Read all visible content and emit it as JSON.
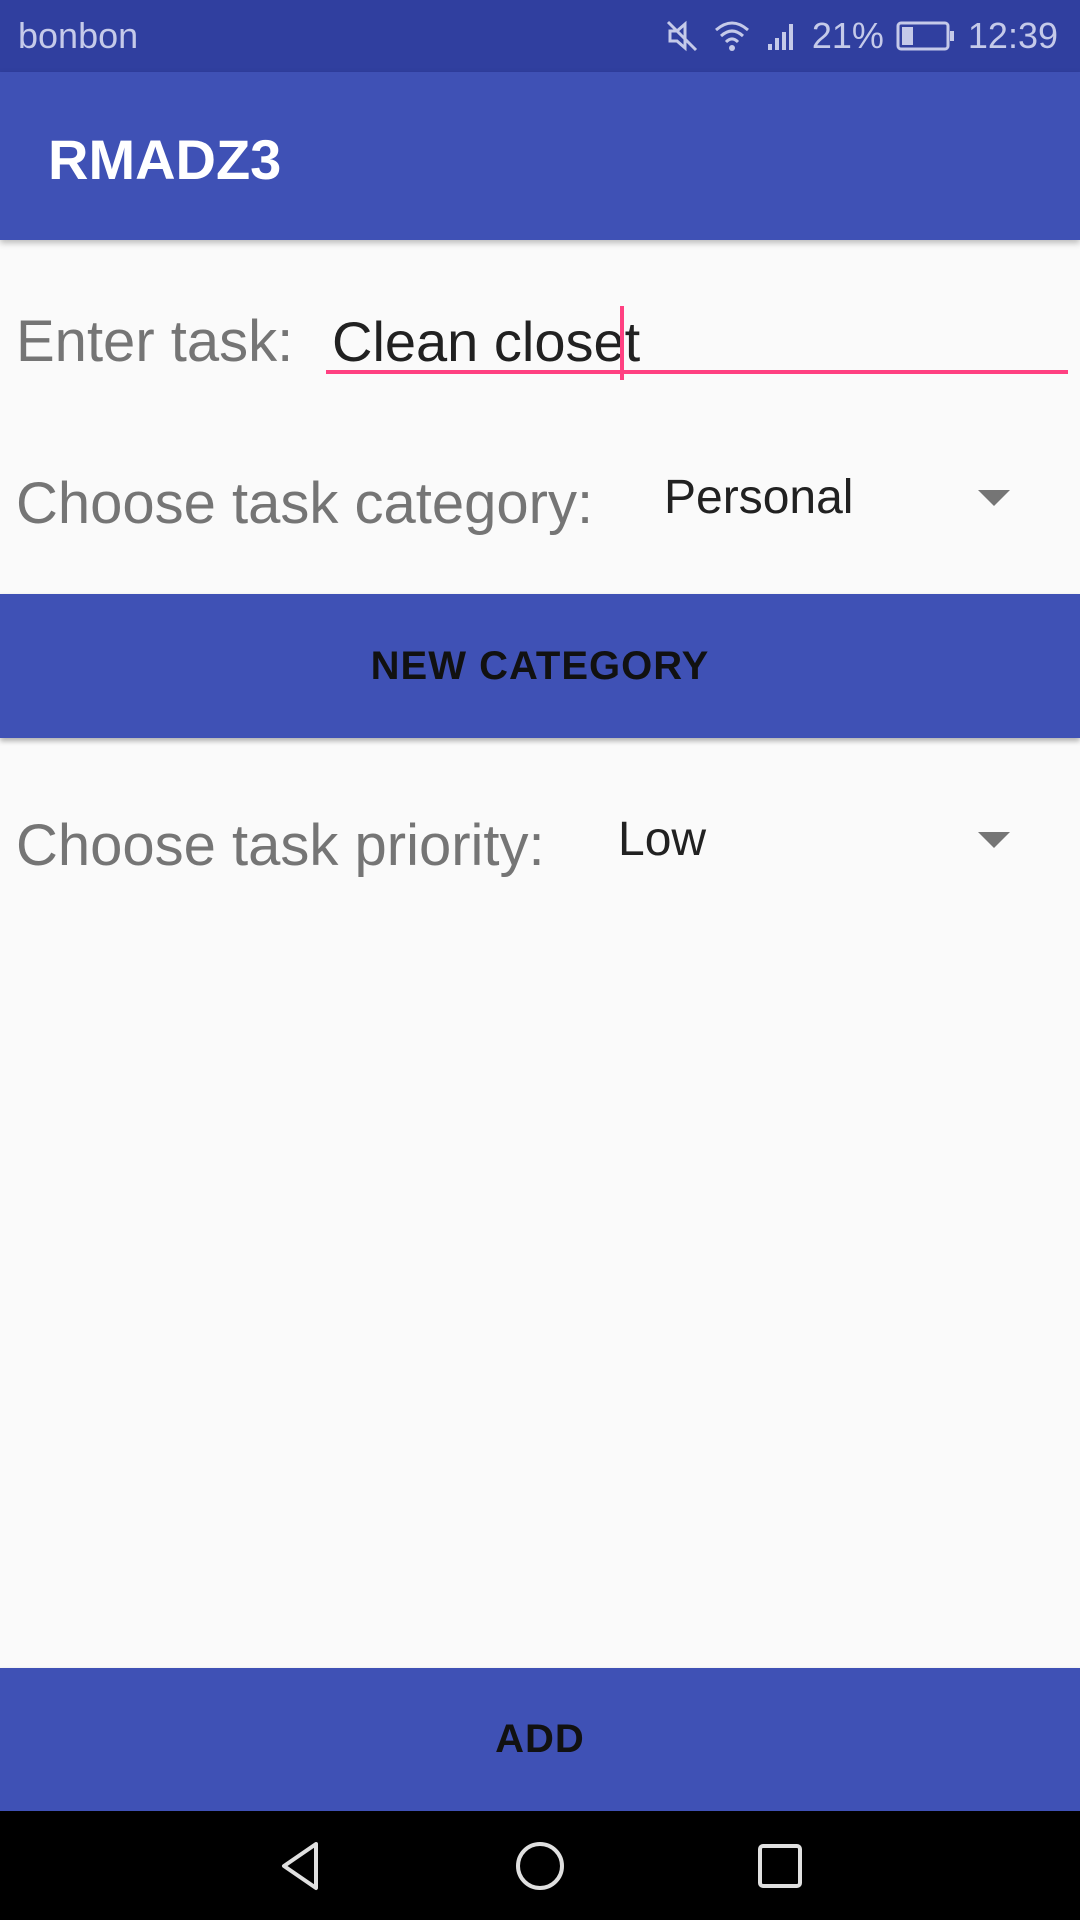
{
  "status_bar": {
    "carrier": "bonbon",
    "battery_percent": "21%",
    "time": "12:39",
    "icons": [
      "mute-icon",
      "wifi-icon",
      "signal-icon",
      "battery-icon"
    ]
  },
  "app_bar": {
    "title": "RMADZ3"
  },
  "form": {
    "task_label": "Enter task:",
    "task_value": "Clean closet",
    "category_label": "Choose task category:",
    "category_value": "Personal",
    "new_category_button": "NEW CATEGORY",
    "priority_label": "Choose task priority:",
    "priority_value": "Low",
    "add_button": "ADD"
  },
  "nav_bar": {
    "icons": [
      "back-icon",
      "home-icon",
      "recents-icon"
    ]
  },
  "colors": {
    "primary": "#3f51b5",
    "primary_dark": "#303f9f",
    "accent": "#ff4081",
    "background": "#fafafa"
  }
}
